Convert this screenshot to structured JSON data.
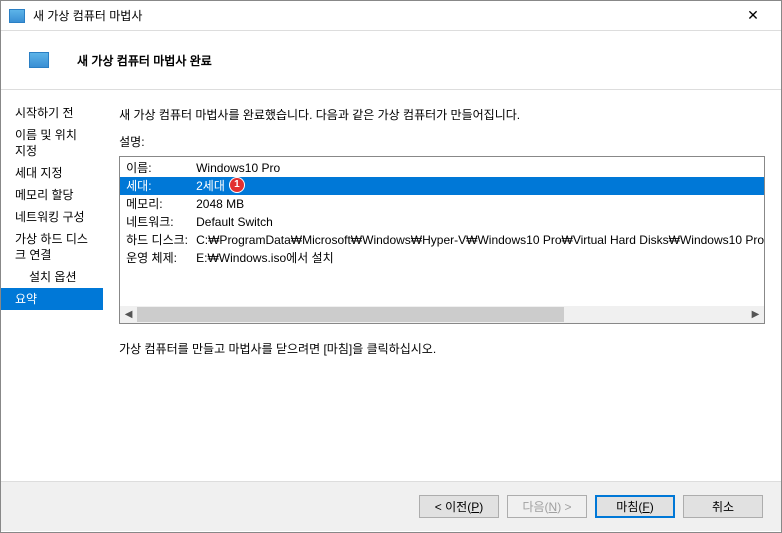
{
  "window": {
    "title": "새 가상 컴퓨터 마법사"
  },
  "header": {
    "title": "새 가상 컴퓨터 마법사 완료"
  },
  "sidebar": {
    "items": [
      {
        "label": "시작하기 전",
        "indent": false,
        "selected": false
      },
      {
        "label": "이름 및 위치 지정",
        "indent": false,
        "selected": false
      },
      {
        "label": "세대 지정",
        "indent": false,
        "selected": false
      },
      {
        "label": "메모리 할당",
        "indent": false,
        "selected": false
      },
      {
        "label": "네트워킹 구성",
        "indent": false,
        "selected": false
      },
      {
        "label": "가상 하드 디스크 연결",
        "indent": false,
        "selected": false
      },
      {
        "label": "설치 옵션",
        "indent": true,
        "selected": false
      },
      {
        "label": "요약",
        "indent": false,
        "selected": true
      }
    ]
  },
  "content": {
    "intro": "새 가상 컴퓨터 마법사를 완료했습니다. 다음과 같은 가상 컴퓨터가 만들어집니다.",
    "description_label": "설명:",
    "summary": [
      {
        "key": "이름:",
        "value": "Windows10 Pro",
        "selected": false
      },
      {
        "key": "세대:",
        "value": "2세대",
        "selected": true,
        "callout": "1"
      },
      {
        "key": "메모리:",
        "value": "2048 MB",
        "selected": false
      },
      {
        "key": "네트워크:",
        "value": "Default Switch",
        "selected": false
      },
      {
        "key": "하드 디스크:",
        "value": "C:₩ProgramData₩Microsoft₩Windows₩Hyper-V₩Windows10 Pro₩Virtual Hard Disks₩Windows10 Pro",
        "selected": false
      },
      {
        "key": "운영 체제:",
        "value": "E:₩Windows.iso에서 설치",
        "selected": false
      }
    ],
    "hint": "가상 컴퓨터를 만들고 마법사를 닫으려면 [마침]을 클릭하십시오."
  },
  "footer": {
    "prev": {
      "prefix": "< 이전(",
      "accel": "P",
      "suffix": ")"
    },
    "next": {
      "prefix": "다음(",
      "accel": "N",
      "suffix": ") >"
    },
    "finish": {
      "prefix": "마침(",
      "accel": "F",
      "suffix": ")"
    },
    "cancel": {
      "label": "취소"
    }
  }
}
